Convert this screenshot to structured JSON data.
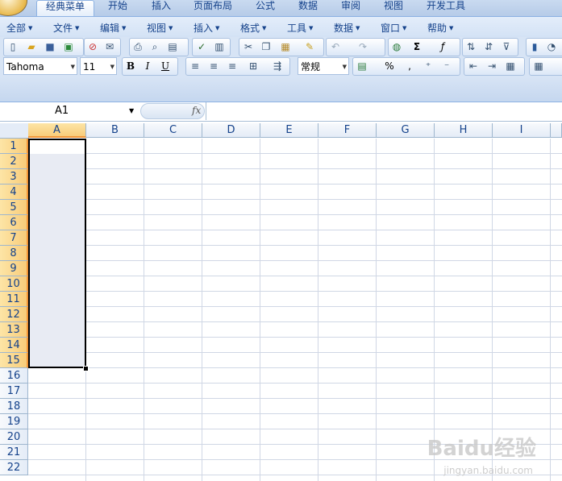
{
  "ribbon_tabs": [
    "经典菜单",
    "开始",
    "插入",
    "页面布局",
    "公式",
    "数据",
    "审阅",
    "视图",
    "开发工具"
  ],
  "menus": [
    "全部",
    "文件",
    "编辑",
    "视图",
    "插入",
    "格式",
    "工具",
    "数据",
    "窗口",
    "帮助"
  ],
  "font": {
    "name": "Tahoma",
    "size": "11"
  },
  "format_combo": "常规",
  "name_box": "A1",
  "fx_label": "fx",
  "columns": [
    "A",
    "B",
    "C",
    "D",
    "E",
    "F",
    "G",
    "H",
    "I"
  ],
  "rows": [
    "1",
    "2",
    "3",
    "4",
    "5",
    "6",
    "7",
    "8",
    "9",
    "10",
    "11",
    "12",
    "13",
    "14",
    "15",
    "16",
    "17",
    "18",
    "19",
    "20",
    "21",
    "22"
  ],
  "selection": {
    "range": "A1:A15"
  },
  "watermark": {
    "text": "Baidu经验",
    "sub": "jingyan.baidu.com"
  }
}
